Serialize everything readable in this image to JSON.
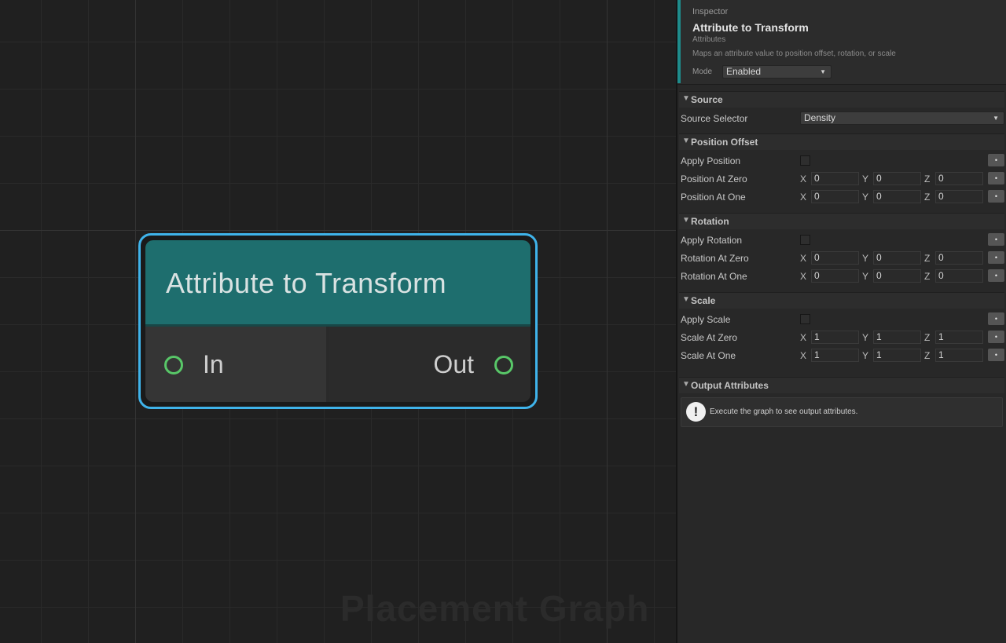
{
  "graph": {
    "watermark": "Placement Graph",
    "node": {
      "title": "Attribute to Transform",
      "input_port": "In",
      "output_port": "Out",
      "selection_color": "#3fb3ea",
      "header_color": "#1e6e6e",
      "port_color": "#58c768"
    }
  },
  "inspector": {
    "kicker": "Inspector",
    "title": "Attribute to Transform",
    "subtitle": "Attributes",
    "description": "Maps an attribute value to position offset, rotation, or scale",
    "mode": {
      "label": "Mode",
      "value": "Enabled"
    },
    "sections": {
      "source": {
        "label": "Source",
        "selector_label": "Source Selector",
        "selector_value": "Density"
      },
      "position": {
        "label": "Position Offset",
        "apply_label": "Apply Position",
        "apply_checked": false,
        "zero": {
          "label": "Position At Zero",
          "x": "0",
          "y": "0",
          "z": "0"
        },
        "one": {
          "label": "Position At One",
          "x": "0",
          "y": "0",
          "z": "0"
        }
      },
      "rotation": {
        "label": "Rotation",
        "apply_label": "Apply Rotation",
        "apply_checked": false,
        "zero": {
          "label": "Rotation At Zero",
          "x": "0",
          "y": "0",
          "z": "0"
        },
        "one": {
          "label": "Rotation At One",
          "x": "0",
          "y": "0",
          "z": "0"
        }
      },
      "scale": {
        "label": "Scale",
        "apply_label": "Apply Scale",
        "apply_checked": false,
        "zero": {
          "label": "Scale At Zero",
          "x": "1",
          "y": "1",
          "z": "1"
        },
        "one": {
          "label": "Scale At One",
          "x": "1",
          "y": "1",
          "z": "1"
        }
      },
      "output": {
        "label": "Output Attributes",
        "help_icon": "!",
        "help_text": "Execute the graph to see output attributes."
      }
    },
    "axes": {
      "x": "X",
      "y": "Y",
      "z": "Z"
    },
    "reset_glyph": "•"
  }
}
